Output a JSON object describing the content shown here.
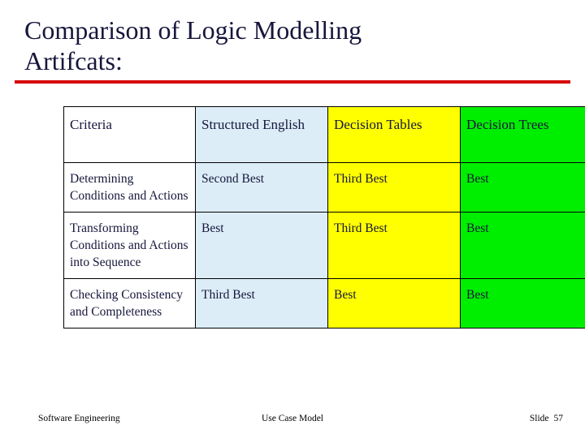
{
  "slide": {
    "title_line1": "Comparison of Logic Modelling",
    "title_line2": "Artifcats:",
    "accent_rule_color": "#d60000",
    "title_color": "#16163c"
  },
  "table": {
    "headers": [
      "Criteria",
      "Structured English",
      "Decision Tables",
      "Decision Trees"
    ],
    "header_colors": [
      "#ffffff",
      "#dcedf7",
      "#ffff00",
      "#00ee00"
    ],
    "rows": [
      {
        "criteria": "Determining Conditions and Actions",
        "structured_english": "Second Best",
        "decision_tables": "Third Best",
        "decision_trees": "Best"
      },
      {
        "criteria": "Transforming Conditions and Actions into Sequence",
        "structured_english": "Best",
        "decision_tables": "Third Best",
        "decision_trees": "Best"
      },
      {
        "criteria": "Checking Consistency and Completeness",
        "structured_english": "Third Best",
        "decision_tables": "Best",
        "decision_trees": "Best"
      }
    ]
  },
  "footer": {
    "left": "Software Engineering",
    "center": "Use Case Model",
    "right_label": "Slide",
    "right_number": "57"
  }
}
